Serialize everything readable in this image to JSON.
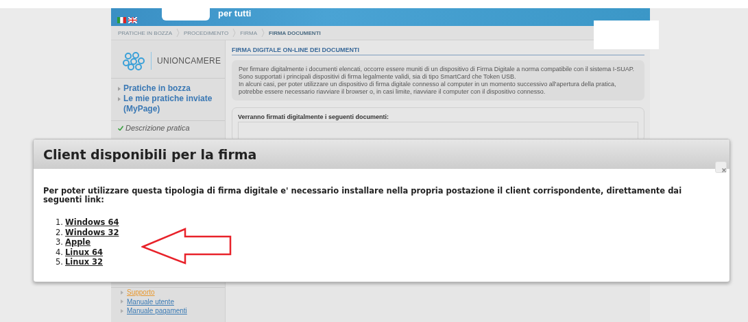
{
  "header": {
    "tagline": "per tutti"
  },
  "breadcrumb": [
    {
      "label": "PRATICHE IN BOZZA",
      "selected": false
    },
    {
      "label": "PROCEDIMENTO",
      "selected": false
    },
    {
      "label": "FIRMA",
      "selected": false
    },
    {
      "label": "FIRMA DOCUMENTI",
      "selected": true
    }
  ],
  "sidebar": {
    "logo": "UNIONCAMERE",
    "links": [
      "Pratiche in bozza",
      "Le mie pratiche inviate (MyPage)"
    ],
    "steps": [
      {
        "label": "Descrizione pratica",
        "done": true
      }
    ],
    "support": [
      {
        "label": "Supporto",
        "kind": "highlight"
      },
      {
        "label": "Manuale utente",
        "kind": "normal"
      },
      {
        "label": "Manuale pagamenti",
        "kind": "normal"
      }
    ]
  },
  "main": {
    "title": "FIRMA DIGITALE ON-LINE DEI DOCUMENTI",
    "info": [
      "Per firmare digitalmente i documenti elencati, occorre essere muniti di un dispositivo di Firma Digitale a norma compatibile con il sistema I-SUAP.",
      "Sono supportati i principali dispositivi di firma legalmente validi, sia di tipo SmartCard che Token USB.",
      "In alcuni casi, per poter utilizzare un dispositivo di firma digitale connesso al computer in un momento successivo all'apertura della pratica, potrebbe essere necessario riavviare il browser o, in casi limite, riavviare il computer con il dispositivo connesso."
    ],
    "documents_label": "Verranno firmati digitalmente i seguenti documenti:"
  },
  "dialog": {
    "title": "Client disponibili per la firma",
    "message": "Per poter utilizzare questa tipologia di firma digitale e' necessario installare nella propria postazione il client corrispondente, direttamente dai seguenti link:",
    "links": [
      {
        "number": "1.",
        "label": "Windows 64"
      },
      {
        "number": "2.",
        "label": "Windows 32"
      },
      {
        "number": "3.",
        "label": "Apple"
      },
      {
        "number": "4.",
        "label": "Linux 64"
      },
      {
        "number": "5.",
        "label": "Linux 32"
      }
    ]
  }
}
